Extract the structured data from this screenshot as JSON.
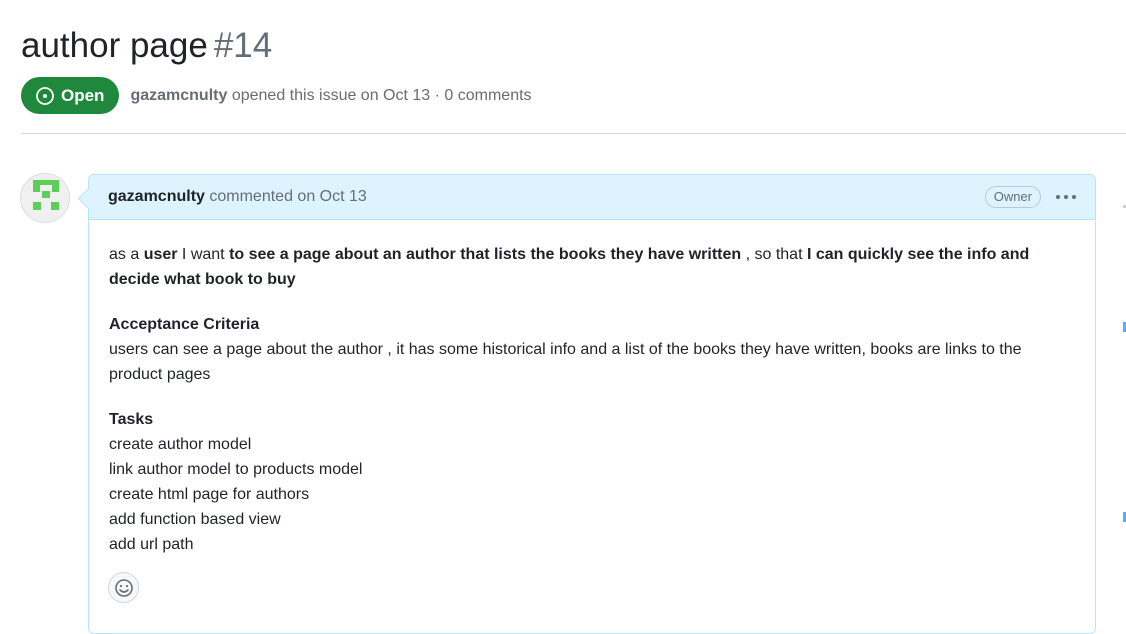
{
  "issue": {
    "title": "author page",
    "number": "#14",
    "state_label": "Open",
    "author": "gazamcnulty",
    "opened_text": "opened this issue on Oct 13 · 0 comments"
  },
  "comment": {
    "author": "gazamcnulty",
    "commented_text": "commented on Oct 13",
    "role_badge": "Owner",
    "story": {
      "p1": "as a ",
      "b1": "user",
      "p2": " I want ",
      "b2": "to see a page about an author that lists the books they have written",
      "p3": " , so that ",
      "b3": "I can quickly see the info and decide what book to buy"
    },
    "acceptance_heading": "Acceptance Criteria",
    "acceptance_text": "users can see a page about the author , it has some historical info and a list of the books they have written, books are links to the product pages",
    "tasks_heading": "Tasks",
    "tasks": [
      "create author model",
      "link author model to products model",
      "create html page for authors",
      "add function based view",
      "add url path"
    ]
  },
  "colors": {
    "open_green": "#1f883d",
    "comment_header_bg": "#ddf4ff",
    "comment_border": "#b6e3ff",
    "muted_text": "#656d76"
  },
  "icons": {
    "state": "issue-opened-icon",
    "menu": "kebab-horizontal-icon",
    "reaction": "smiley-icon"
  }
}
